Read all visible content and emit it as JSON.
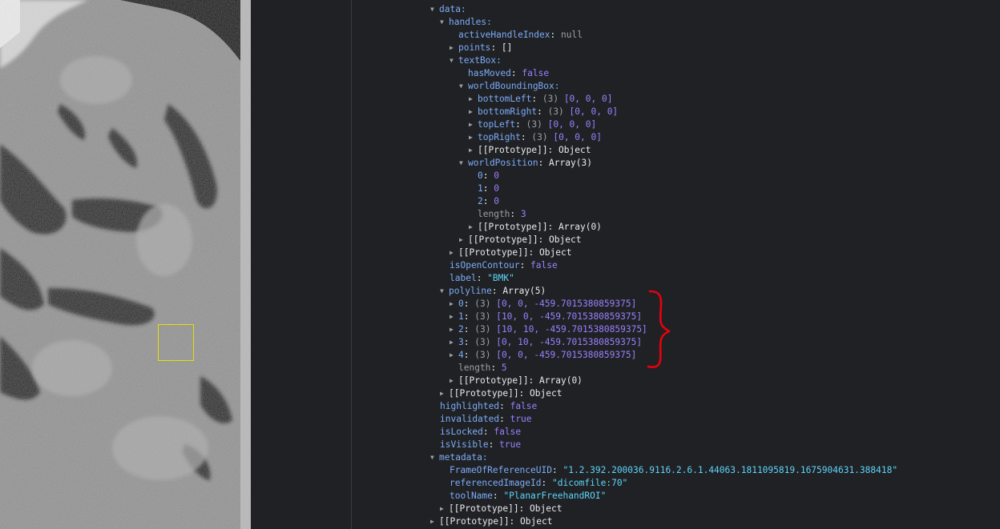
{
  "viewer": {
    "roi_color": "#e6e000",
    "annotation_color": "#e8000c"
  },
  "tree": {
    "data": "data:",
    "handles": "handles:",
    "activeHandleIndex_key": "activeHandleIndex",
    "activeHandleIndex_val": "null",
    "points_key": "points",
    "points_val": "[]",
    "textBox": "textBox:",
    "hasMoved_key": "hasMoved",
    "hasMoved_val": "false",
    "worldBoundingBox": "worldBoundingBox:",
    "bottomLeft_key": "bottomLeft",
    "bottomLeft_len": "(3)",
    "bottomLeft_val": "[0, 0, 0]",
    "bottomRight_key": "bottomRight",
    "bottomRight_len": "(3)",
    "bottomRight_val": "[0, 0, 0]",
    "topLeft_key": "topLeft",
    "topLeft_len": "(3)",
    "topLeft_val": "[0, 0, 0]",
    "topRight_key": "topRight",
    "topRight_len": "(3)",
    "topRight_val": "[0, 0, 0]",
    "proto_object": "[[Prototype]]: Object",
    "worldPosition_key": "worldPosition",
    "worldPosition_val": "Array(3)",
    "wp0_key": "0",
    "wp0_val": "0",
    "wp1_key": "1",
    "wp1_val": "0",
    "wp2_key": "2",
    "wp2_val": "0",
    "length_key": "length",
    "wp_length_val": "3",
    "proto_array0": "[[Prototype]]: Array(0)",
    "isOpenContour_key": "isOpenContour",
    "isOpenContour_val": "false",
    "label_key": "label",
    "label_val": "\"BMK\"",
    "polyline_key": "polyline",
    "polyline_val": "Array(5)",
    "pl0_key": "0",
    "pl0_len": "(3)",
    "pl0_val": "[0, 0, -459.7015380859375]",
    "pl1_key": "1",
    "pl1_len": "(3)",
    "pl1_val": "[10, 0, -459.7015380859375]",
    "pl2_key": "2",
    "pl2_len": "(3)",
    "pl2_val": "[10, 10, -459.7015380859375]",
    "pl3_key": "3",
    "pl3_len": "(3)",
    "pl3_val": "[0, 10, -459.7015380859375]",
    "pl4_key": "4",
    "pl4_len": "(3)",
    "pl4_val": "[0, 0, -459.7015380859375]",
    "pl_length_val": "5",
    "highlighted_key": "highlighted",
    "highlighted_val": "false",
    "invalidated_key": "invalidated",
    "invalidated_val": "true",
    "isLocked_key": "isLocked",
    "isLocked_val": "false",
    "isVisible_key": "isVisible",
    "isVisible_val": "true",
    "metadata": "metadata:",
    "frameOfRef_key": "FrameOfReferenceUID",
    "frameOfRef_val": "\"1.2.392.200036.9116.2.6.1.44063.1811095819.1675904631.388418\"",
    "refImageId_key": "referencedImageId",
    "refImageId_val": "\"dicomfile:70\"",
    "toolName_key": "toolName",
    "toolName_val": "\"PlanarFreehandROI\""
  }
}
